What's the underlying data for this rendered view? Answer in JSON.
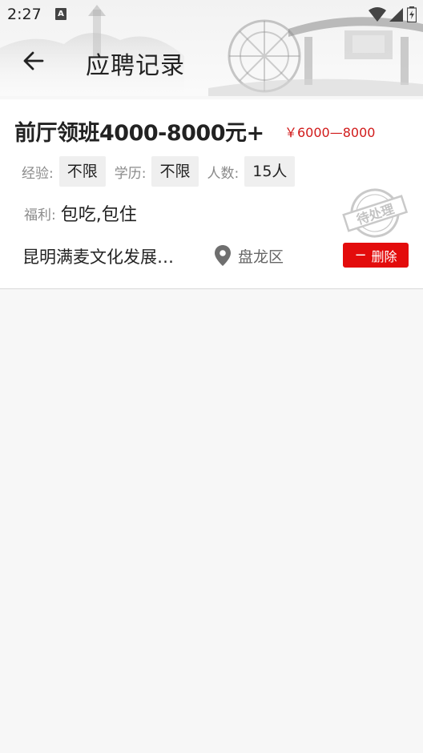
{
  "status_bar": {
    "time": "2:27",
    "notification_letter": "A"
  },
  "header": {
    "title": "应聘记录"
  },
  "application": {
    "job_title": "前厅领班4000-8000元+",
    "salary": "￥6000—8000",
    "requirements": [
      {
        "label": "经验:",
        "value": "不限"
      },
      {
        "label": "学历:",
        "value": "不限"
      },
      {
        "label": "人数:",
        "value": "15人"
      }
    ],
    "benefits_label": "福利:",
    "benefits_value": "包吃,包住",
    "stamp_text": "待处理",
    "company": "昆明满麦文化发展…",
    "district": "盘龙区",
    "delete_label": "删除"
  },
  "colors": {
    "accent_red": "#e30c0c",
    "salary_red": "#d11a1a",
    "stamp_gray": "#b8b8b8"
  }
}
